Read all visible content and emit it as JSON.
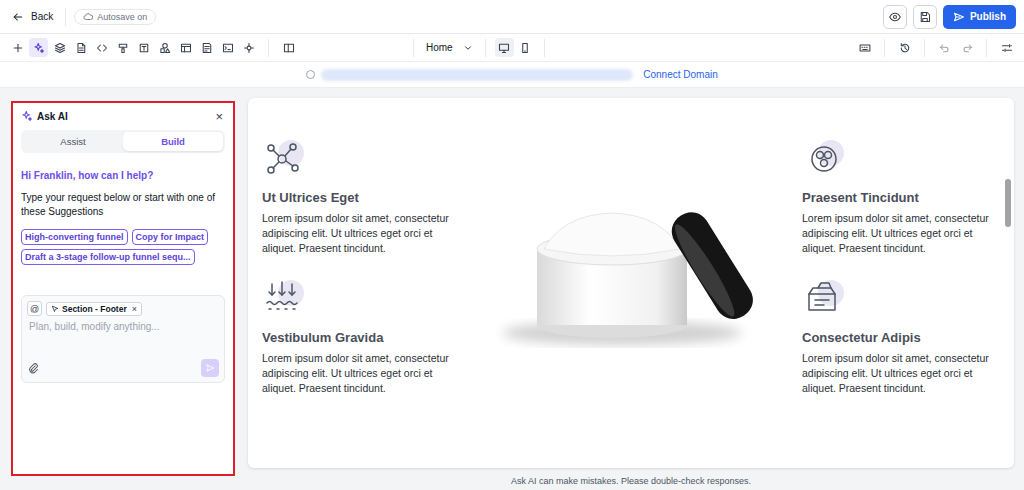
{
  "topbar": {
    "back": "Back",
    "autosave": "Autosave on",
    "publish": "Publish"
  },
  "toolbar": {
    "tools": [
      {
        "selected": false
      },
      {
        "selected": true
      },
      {
        "selected": false
      },
      {
        "selected": false
      },
      {
        "selected": false
      },
      {
        "selected": false
      },
      {
        "selected": false
      },
      {
        "selected": false
      },
      {
        "selected": false
      },
      {
        "selected": false
      },
      {
        "selected": false
      },
      {
        "selected": false
      }
    ],
    "page": "Home",
    "devices": [
      {
        "selected": true
      },
      {
        "selected": false
      }
    ]
  },
  "address_bar": {
    "link": "Connect Domain"
  },
  "ai_panel": {
    "highlighted": true,
    "title": "Ask AI",
    "close": "×",
    "tabs": [
      {
        "label": "Assist",
        "selected": false
      },
      {
        "label": "Build",
        "selected": true
      }
    ],
    "greeting": "Hi Franklin, how can I help?",
    "intro": "Type your request below or start with one of these Suggestions",
    "suggestions": [
      "High-converting funnel",
      "Copy for Impact",
      "Draft a 3-stage follow-up funnel sequ..."
    ],
    "composer": {
      "mention": "@",
      "context": {
        "label": "Section - Footer",
        "remove": "×"
      },
      "placeholder": "Plan, build, modify anything...",
      "send_enabled": false
    }
  },
  "canvas": {
    "features": [
      {
        "title": "Ut Ultrices Eget",
        "body": "Lorem ipsum dolor sit amet, consectetur adipiscing elit. Ut ultrices eget orci et aliquet. Praesent tincidunt."
      },
      {
        "title": "Praesent Tincidunt",
        "body": "Lorem ipsum dolor sit amet, consectetur adipiscing elit. Ut ultrices eget orci et aliquet. Praesent tincidunt."
      },
      {
        "title": "Vestibulum Gravida",
        "body": "Lorem ipsum dolor sit amet, consectetur adipiscing elit. Ut ultrices eget orci et aliquet. Praesent tincidunt."
      },
      {
        "title": "Consectetur Adipis",
        "body": "Lorem ipsum dolor sit amet, consectetur adipiscing elit. Ut ultrices eget orci et aliquet. Praesent tincidunt."
      }
    ],
    "scrollbar": {
      "level": 0.25
    }
  },
  "disclaimer": "Ask AI can make mistakes. Please double-check responses."
}
